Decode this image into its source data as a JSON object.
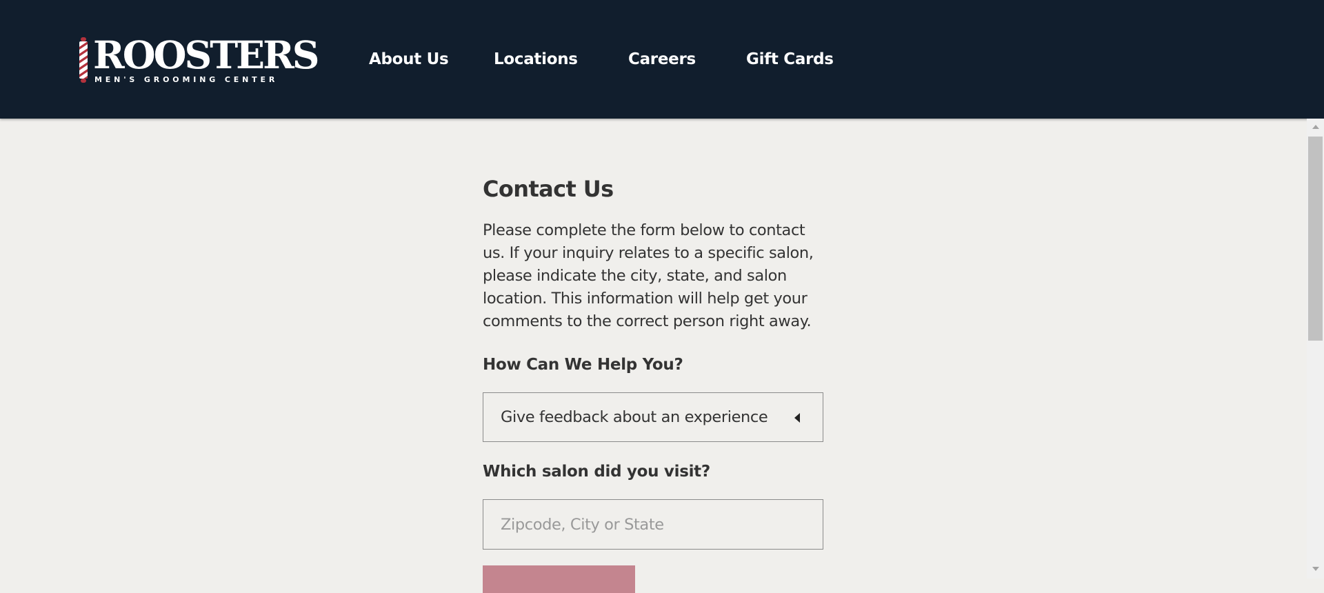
{
  "header": {
    "logo": {
      "wordmark": "ROOSTERS",
      "tagline": "MEN'S GROOMING CENTER",
      "registered_mark": "®"
    },
    "nav": [
      {
        "label": "About Us"
      },
      {
        "label": "Locations"
      },
      {
        "label": "Careers"
      },
      {
        "label": "Gift Cards"
      }
    ]
  },
  "main": {
    "title": "Contact Us",
    "intro": "Please complete the form below to contact us. If your inquiry relates to a specific salon, please indicate the city, state, and salon location. This information will help get your comments to the correct person right away.",
    "help_label": "How Can We Help You?",
    "help_select": {
      "selected": "Give feedback about an experience"
    },
    "salon_label": "Which salon did you visit?",
    "salon_input": {
      "value": "",
      "placeholder": "Zipcode, City or State"
    }
  },
  "colors": {
    "header_bg": "#111e2d",
    "page_bg": "#f0efec",
    "brand_red": "#b3323d",
    "button_pink": "#c4858f",
    "text": "#333333"
  },
  "icons": {
    "logo_pole": "barber-pole-icon",
    "select_caret": "caret-left-icon"
  }
}
